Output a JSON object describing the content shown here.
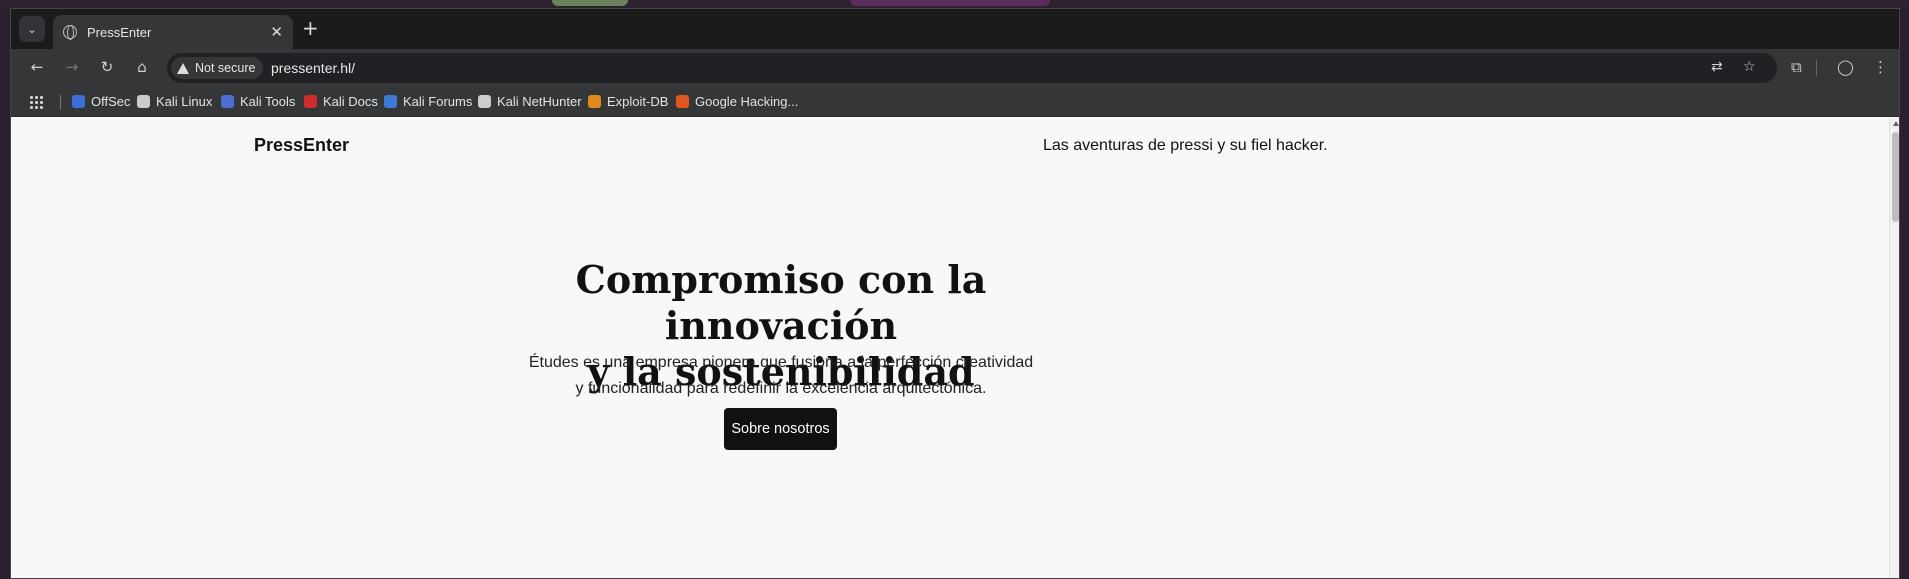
{
  "browser": {
    "tab_title": "PressEnter",
    "close_glyph": "✕",
    "new_tab_glyph": "+",
    "tab_search_glyph": "⌄",
    "security_label": "Not secure",
    "url": "pressenter.hl/",
    "nav": {
      "back": "←",
      "forward": "→",
      "reload": "↻",
      "home": "⌂"
    },
    "icons": {
      "translate": "⇄",
      "bookmark_star": "☆",
      "extensions": "⧉",
      "profile": "◯",
      "menu": "⋮"
    }
  },
  "bookmarks": [
    {
      "label": "OffSec",
      "icon": "offsec-icon",
      "color": "#3b6fd8"
    },
    {
      "label": "Kali Linux",
      "icon": "kali-dragon-icon",
      "color": "#cccccc"
    },
    {
      "label": "Kali Tools",
      "icon": "kali-tools-icon",
      "color": "#4e6fd1"
    },
    {
      "label": "Kali Docs",
      "icon": "kali-docs-icon",
      "color": "#d12b2b"
    },
    {
      "label": "Kali Forums",
      "icon": "kali-forums-icon",
      "color": "#3d7bd6"
    },
    {
      "label": "Kali NetHunter",
      "icon": "nethunter-icon",
      "color": "#cccccc"
    },
    {
      "label": "Exploit-DB",
      "icon": "exploit-db-icon",
      "color": "#e08a1e"
    },
    {
      "label": "Google Hacking...",
      "icon": "ghdb-icon",
      "color": "#e0561e"
    }
  ],
  "site": {
    "title": "PressEnter",
    "tagline": "Las aventuras de pressi y su fiel hacker.",
    "hero_line1": "Compromiso con la innovación",
    "hero_line2": "y la sostenibilidad",
    "sub_line1": "Études es una empresa pionera que fusiona a la perfección creatividad",
    "sub_line2": "y funcionalidad para redefinir la excelencia arquitectónica.",
    "button": "Sobre nosotros"
  }
}
